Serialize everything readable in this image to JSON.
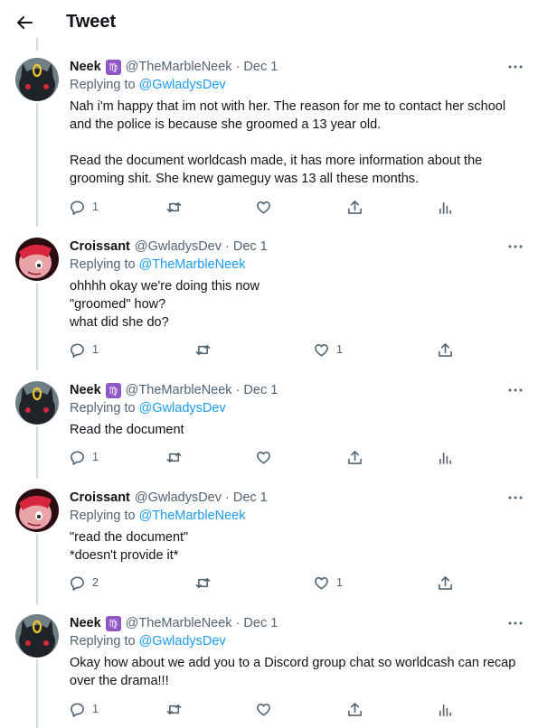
{
  "header": {
    "title": "Tweet",
    "back_icon": "arrow-left-icon"
  },
  "colors": {
    "link": "#1d9bf0",
    "muted": "#536471",
    "badge": "#8e57c6",
    "line": "#cfd9de"
  },
  "tweets": [
    {
      "author": "Neek",
      "badge": "♍",
      "handle": "@TheMarbleNeek",
      "date": "Dec 1",
      "replying_label": "Replying to",
      "replying_to": "@GwladysDev",
      "text": "Nah i'm happy that im not with her. The reason for me to contact her school and the police is because she groomed a 13 year old.\n\nRead the document worldcash made, it has more information about the grooming shit. She knew gameguy was 13 all these months.",
      "reply_count": "1",
      "retweet_count": "",
      "like_count": ""
    },
    {
      "author": "Croissant",
      "badge": "",
      "handle": "@GwladysDev",
      "date": "Dec 1",
      "replying_label": "Replying to",
      "replying_to": "@TheMarbleNeek",
      "text": "ohhhh okay we're doing this now\n\"groomed\" how?\nwhat did she do?",
      "reply_count": "1",
      "retweet_count": "",
      "like_count": "1"
    },
    {
      "author": "Neek",
      "badge": "♍",
      "handle": "@TheMarbleNeek",
      "date": "Dec 1",
      "replying_label": "Replying to",
      "replying_to": "@GwladysDev",
      "text": "Read the document",
      "reply_count": "1",
      "retweet_count": "",
      "like_count": ""
    },
    {
      "author": "Croissant",
      "badge": "",
      "handle": "@GwladysDev",
      "date": "Dec 1",
      "replying_label": "Replying to",
      "replying_to": "@TheMarbleNeek",
      "text": "\"read the document\"\n*doesn't provide it*",
      "reply_count": "2",
      "retweet_count": "",
      "like_count": "1"
    },
    {
      "author": "Neek",
      "badge": "♍",
      "handle": "@TheMarbleNeek",
      "date": "Dec 1",
      "replying_label": "Replying to",
      "replying_to": "@GwladysDev",
      "text": "Okay how about we add you to a Discord group chat so worldcash can recap over the drama!!!",
      "reply_count": "1",
      "retweet_count": "",
      "like_count": ""
    }
  ]
}
